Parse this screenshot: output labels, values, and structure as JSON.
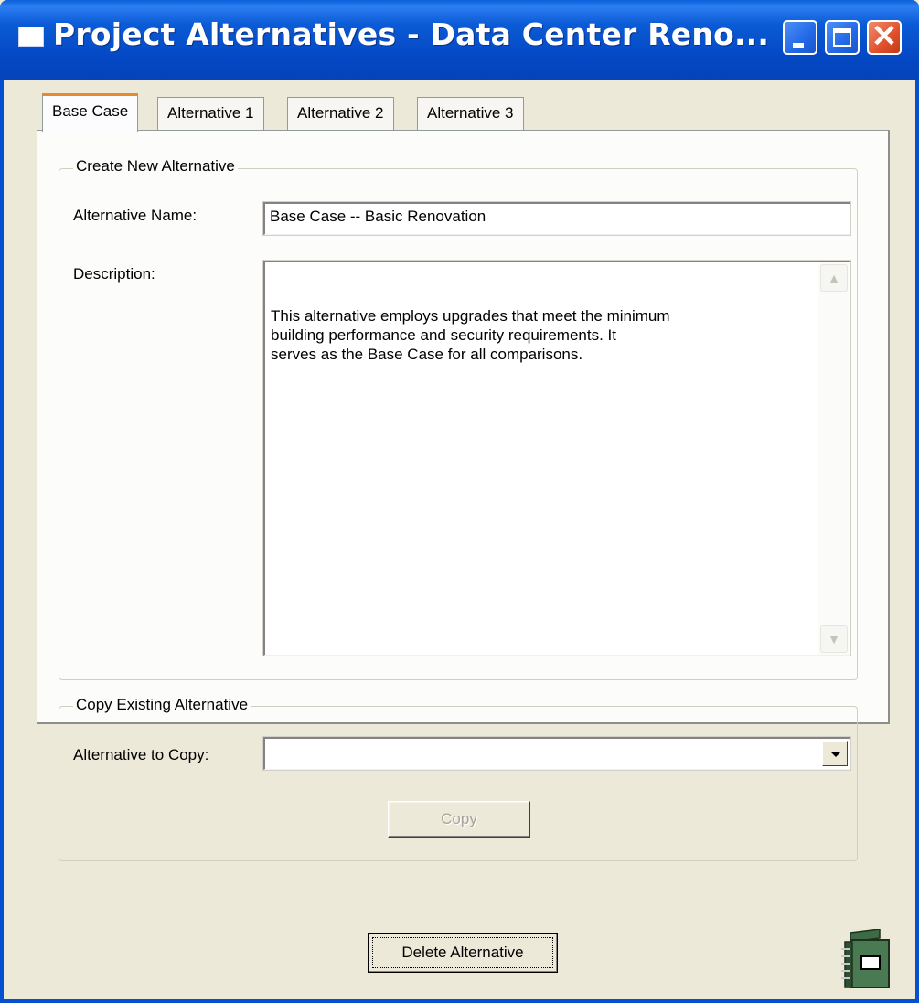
{
  "window": {
    "title": "Project Alternatives - Data Center Reno..."
  },
  "tabs": [
    {
      "label": "Base Case",
      "active": true
    },
    {
      "label": "Alternative 1",
      "active": false
    },
    {
      "label": "Alternative 2",
      "active": false
    },
    {
      "label": "Alternative 3",
      "active": false
    }
  ],
  "create_group": {
    "title": "Create New Alternative",
    "name_label": "Alternative Name:",
    "name_value": "Base Case -- Basic Renovation",
    "description_label": "Description:",
    "description_value": "This alternative employs upgrades that meet the minimum\nbuilding performance and security requirements. It\nserves as the Base Case for all comparisons."
  },
  "copy_group": {
    "title": "Copy Existing Alternative",
    "copy_label": "Alternative to Copy:",
    "copy_value": "",
    "copy_button": "Copy"
  },
  "footer": {
    "delete_button": "Delete Alternative",
    "book_icon": "green-notebook-icon"
  },
  "colors": {
    "titlebar": "#0550d0",
    "window_bg": "#ece9d8",
    "panel_bg": "#fcfcfa",
    "active_tab_accent": "#e68b2c",
    "close_button": "#e0502d",
    "notebook": "#4a7a52"
  }
}
